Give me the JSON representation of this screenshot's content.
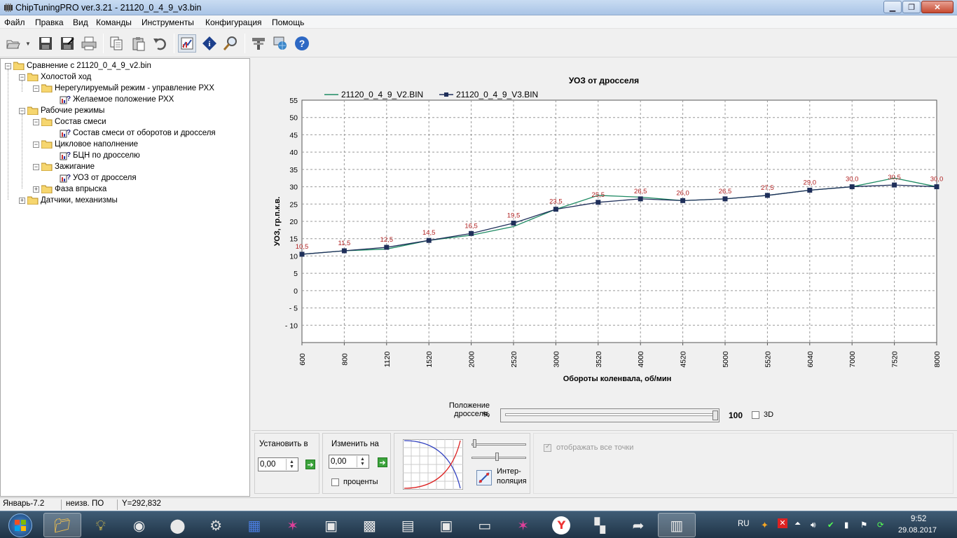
{
  "window": {
    "title": "ChipTuningPRO ver.3.21 - 21120_0_4_9_v3.bin",
    "min_icon": "minimize-icon",
    "max_icon": "maximize-icon",
    "close_icon": "close-icon"
  },
  "menu": [
    "Файл",
    "Правка",
    "Вид",
    "Команды",
    "Инструменты",
    "Конфигурация",
    "Помощь"
  ],
  "toolbar_icons": [
    "open-folder-icon",
    "dropdown-arrow-icon",
    "save-icon",
    "save-as-icon",
    "print-icon",
    "copy-icon",
    "paste-icon",
    "undo-icon",
    "chart-view-icon",
    "info-icon",
    "search-icon",
    "tools-icon",
    "network-icon",
    "help-icon"
  ],
  "tree": {
    "root": "Сравнение с 21120_0_4_9_v2.bin",
    "idle": "Холостой ход",
    "idle_unregulated": "Нерегулируемый режим - управление РХХ",
    "idle_desired": "Желаемое положение РХХ",
    "work_modes": "Рабочие режимы",
    "mixture": "Состав смеси",
    "mixture_map": "Состав смеси от оборотов и дросселя",
    "cyclic_fill": "Цикловое наполнение",
    "bcn": "БЦН по дросселю",
    "ignition": "Зажигание",
    "uoz": "УОЗ от дросселя",
    "injection_phase": "Фаза впрыска",
    "sensors": "Датчики, механизмы"
  },
  "chart_data": {
    "type": "line",
    "title": "УОЗ от дросселя",
    "xlabel": "Обороты коленвала, об/мин",
    "ylabel": "УОЗ, гр.п.к.в.",
    "categories": [
      "600",
      "800",
      "1120",
      "1520",
      "2000",
      "2520",
      "3000",
      "3520",
      "4000",
      "4520",
      "5000",
      "5520",
      "6040",
      "7000",
      "7520",
      "8000"
    ],
    "ylim": [
      -15,
      55
    ],
    "yticks": [
      "55",
      "50",
      "45",
      "40",
      "35",
      "30",
      "25",
      "20",
      "15",
      "10",
      "5",
      "0",
      "- 5",
      "- 10"
    ],
    "grid": true,
    "legend_placement": "top",
    "series": [
      {
        "name": "21120_0_4_9_V2.BIN",
        "color": "#1e8a63",
        "values": [
          10.5,
          11.5,
          12.0,
          14.5,
          16.0,
          18.5,
          23.5,
          27.5,
          27.0,
          26.0,
          26.5,
          27.5,
          29.0,
          30.0,
          32.5,
          30.0
        ]
      },
      {
        "name": "21120_0_4_9_V3.BIN",
        "color": "#1f2f5a",
        "values": [
          10.5,
          11.5,
          12.5,
          14.5,
          16.5,
          19.5,
          23.5,
          25.5,
          26.5,
          26.0,
          26.5,
          27.5,
          29.0,
          30.0,
          30.5,
          30.0
        ]
      }
    ],
    "data_labels": [
      "10,5",
      "11,5",
      "12,5",
      "14,5",
      "16,5",
      "19,5",
      "23,5",
      "25,5",
      "26,5",
      "26,0",
      "26,5",
      "27,5",
      "29,0",
      "30,0",
      "30,5",
      "30,0"
    ],
    "label_color": "#b02020"
  },
  "throttle": {
    "label": "Положение дросселя,",
    "unit": "%",
    "value": "100",
    "level": 1.0,
    "check_3d": "3D"
  },
  "controls": {
    "set_label": "Установить в",
    "set_value": "0,00",
    "change_label": "Изменить на",
    "change_value": "0,00",
    "percent_label": "проценты",
    "interp_label_1": "Интер-",
    "interp_label_2": "поляция",
    "show_all_points": "отображать все точки"
  },
  "status": {
    "firmware": "Январь-7.2",
    "state": "неизв. ПО",
    "y_coord": "Y=292,832"
  },
  "taskbar": {
    "lang": "RU",
    "time": "9:52",
    "date": "29.08.2017",
    "apps": [
      "explorer-icon",
      "bulb-icon",
      "scanner-icon",
      "ecu-icon",
      "gear-icon",
      "buildings-icon",
      "star-icon",
      "app-window-icon",
      "engine-icon",
      "chip-v2-icon",
      "app-window-icon",
      "terminal-icon",
      "star-icon",
      "yandex-icon",
      "checker-icon",
      "folder-arrow-icon",
      "chip-icon"
    ]
  }
}
